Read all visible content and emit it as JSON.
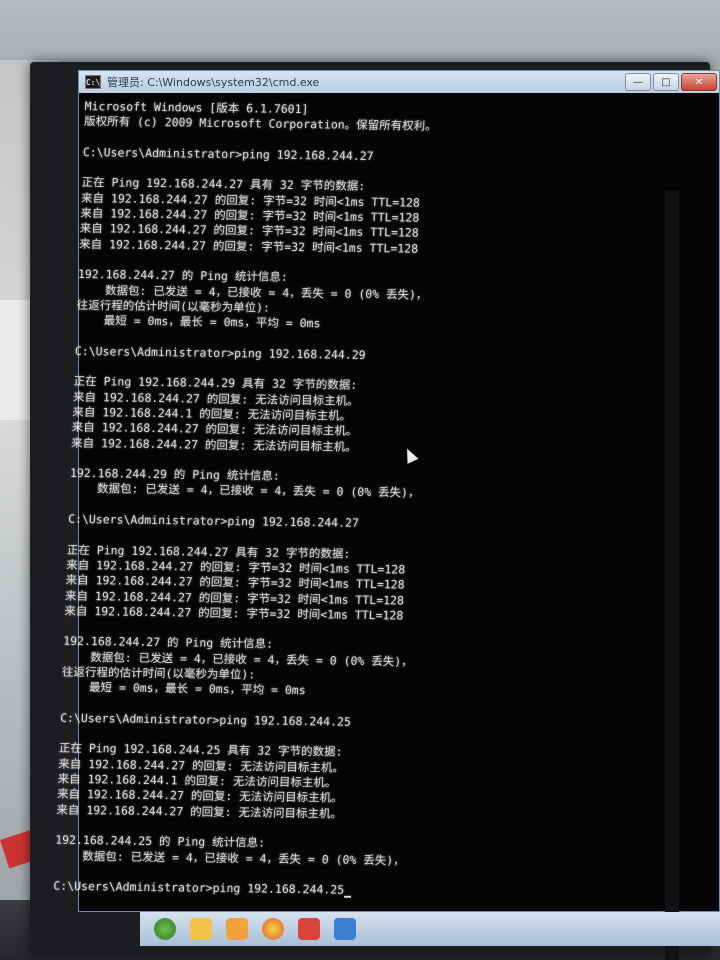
{
  "window": {
    "title": "管理员: C:\\Windows\\system32\\cmd.exe",
    "icon_text": "C:\\",
    "buttons": {
      "minimize": "—",
      "maximize": "□",
      "close": "✕"
    }
  },
  "console": {
    "lines": [
      "Microsoft Windows [版本 6.1.7601]",
      "版权所有 (c) 2009 Microsoft Corporation。保留所有权利。",
      "",
      "C:\\Users\\Administrator>ping 192.168.244.27",
      "",
      "正在 Ping 192.168.244.27 具有 32 字节的数据:",
      "来自 192.168.244.27 的回复: 字节=32 时间<1ms TTL=128",
      "来自 192.168.244.27 的回复: 字节=32 时间<1ms TTL=128",
      "来自 192.168.244.27 的回复: 字节=32 时间<1ms TTL=128",
      "来自 192.168.244.27 的回复: 字节=32 时间<1ms TTL=128",
      "",
      "192.168.244.27 的 Ping 统计信息:",
      "    数据包: 已发送 = 4，已接收 = 4，丢失 = 0 (0% 丢失)，",
      "往返行程的估计时间(以毫秒为单位):",
      "    最短 = 0ms，最长 = 0ms，平均 = 0ms",
      "",
      "C:\\Users\\Administrator>ping 192.168.244.29",
      "",
      "正在 Ping 192.168.244.29 具有 32 字节的数据:",
      "来自 192.168.244.27 的回复: 无法访问目标主机。",
      "来自 192.168.244.1 的回复: 无法访问目标主机。",
      "来自 192.168.244.27 的回复: 无法访问目标主机。",
      "来自 192.168.244.27 的回复: 无法访问目标主机。",
      "",
      "192.168.244.29 的 Ping 统计信息:",
      "    数据包: 已发送 = 4，已接收 = 4，丢失 = 0 (0% 丢失)，",
      "",
      "C:\\Users\\Administrator>ping 192.168.244.27",
      "",
      "正在 Ping 192.168.244.27 具有 32 字节的数据:",
      "来自 192.168.244.27 的回复: 字节=32 时间<1ms TTL=128",
      "来自 192.168.244.27 的回复: 字节=32 时间<1ms TTL=128",
      "来自 192.168.244.27 的回复: 字节=32 时间<1ms TTL=128",
      "来自 192.168.244.27 的回复: 字节=32 时间<1ms TTL=128",
      "",
      "192.168.244.27 的 Ping 统计信息:",
      "    数据包: 已发送 = 4，已接收 = 4，丢失 = 0 (0% 丢失)，",
      "往返行程的估计时间(以毫秒为单位):",
      "    最短 = 0ms，最长 = 0ms，平均 = 0ms",
      "",
      "C:\\Users\\Administrator>ping 192.168.244.25",
      "",
      "正在 Ping 192.168.244.25 具有 32 字节的数据:",
      "来自 192.168.244.27 的回复: 无法访问目标主机。",
      "来自 192.168.244.1 的回复: 无法访问目标主机。",
      "来自 192.168.244.27 的回复: 无法访问目标主机。",
      "来自 192.168.244.27 的回复: 无法访问目标主机。",
      "",
      "192.168.244.25 的 Ping 统计信息:",
      "    数据包: 已发送 = 4，已接收 = 4，丢失 = 0 (0% 丢失)，",
      "",
      "C:\\Users\\Administrator>ping 192.168.244.25"
    ]
  },
  "taskbar": {
    "icons": [
      "start-orb-icon",
      "folder-icon",
      "folder-icon",
      "browser-icon",
      "app-icon",
      "window-icon"
    ]
  },
  "colors": {
    "console_bg": "#050505",
    "console_text": "#d9d9d9",
    "titlebar": "#c8d8ea"
  }
}
